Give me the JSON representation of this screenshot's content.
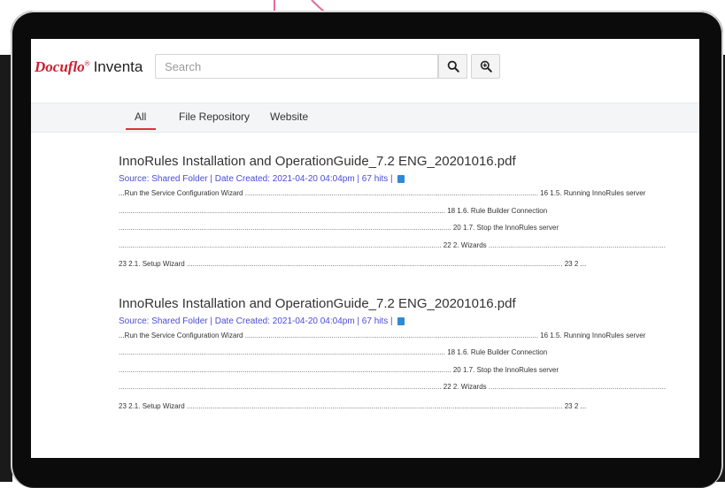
{
  "app": {
    "brand": "Docuflo",
    "brand_mark": "®",
    "product": "Inventa"
  },
  "search": {
    "placeholder": "Search",
    "value": ""
  },
  "icons": {
    "search": "search-icon",
    "advanced_search": "zoom-in-icon",
    "document": "document-icon"
  },
  "tabs": [
    {
      "label": "All",
      "active": true
    },
    {
      "label": "File Repository",
      "active": false
    },
    {
      "label": "Website",
      "active": false
    }
  ],
  "colors": {
    "brand_red": "#c8202f",
    "active_tab_underline": "#d9333f",
    "meta_link": "#4b4bd6",
    "doc_icon": "#2c8bd6"
  },
  "results": [
    {
      "title": "InnoRules Installation and OperationGuide_7.2 ENG_20201016.pdf",
      "meta": "Source: Shared Folder | Date Created: 2021-04-20 04:04pm | 67 hits |",
      "lines": [
        {
          "prefix": "...Run the Service Configuration Wizard",
          "text": "16 1.5. Running InnoRules server"
        },
        {
          "prefix": "",
          "text": "18 1.6. Rule Builder Connection"
        },
        {
          "prefix": "",
          "text": "20 1.7. Stop the InnoRules server"
        },
        {
          "prefix": "",
          "text": "22 2. Wizards"
        },
        {
          "prefix": "23 2.1. Setup Wizard",
          "text": "23 2 ..."
        }
      ]
    },
    {
      "title": "InnoRules Installation and OperationGuide_7.2 ENG_20201016.pdf",
      "meta": "Source: Shared Folder | Date Created: 2021-04-20 04:04pm | 67 hits |",
      "lines": [
        {
          "prefix": "...Run the Service Configuration Wizard",
          "text": "16 1.5. Running InnoRules server"
        },
        {
          "prefix": "",
          "text": "18 1.6. Rule Builder Connection"
        },
        {
          "prefix": "",
          "text": "20 1.7. Stop the InnoRules server"
        },
        {
          "prefix": "",
          "text": "22 2. Wizards"
        },
        {
          "prefix": "23 2.1. Setup Wizard",
          "text": "23 2 ..."
        }
      ]
    }
  ]
}
